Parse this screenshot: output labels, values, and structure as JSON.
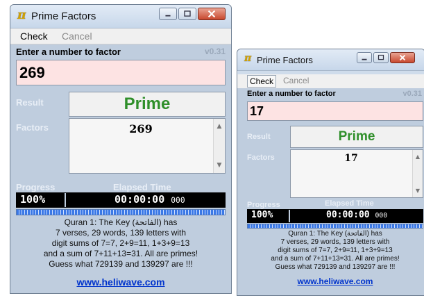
{
  "windows": [
    {
      "title": "Prime Factors",
      "app_glyph": "π",
      "menu": {
        "check": "Check",
        "cancel": "Cancel"
      },
      "prompt": "Enter a number to factor",
      "version": "v0.31",
      "number_value": "269",
      "result_label": "Result",
      "result_value": "Prime",
      "factors_label": "Factors",
      "factors_value": "269",
      "progress_label": "Progress",
      "elapsed_label": "Elapsed Time",
      "progress_value": "100%",
      "progress_fraction": 1.0,
      "elapsed_value": "00:00:00",
      "elapsed_ms": "000",
      "note_lines": [
        "Quran 1: The Key (الفاتحة) has",
        "7 verses, 29 words, 139 letters with",
        "digit sums of 7=7, 2+9=11, 1+3+9=13",
        "and a sum of 7+11+13=31. All are primes!",
        "Guess what 729139 and 139297 are !!!"
      ],
      "link_text": "www.heliwave.com"
    },
    {
      "title": "Prime Factors",
      "app_glyph": "π",
      "menu": {
        "check": "Check",
        "cancel": "Cancel"
      },
      "prompt": "Enter a number to factor",
      "version": "v0.31",
      "number_value": "17",
      "result_label": "Result",
      "result_value": "Prime",
      "factors_label": "Factors",
      "factors_value": "17",
      "progress_label": "Progress",
      "elapsed_label": "Elapsed Time",
      "progress_value": "100%",
      "progress_fraction": 1.0,
      "elapsed_value": "00:00:00",
      "elapsed_ms": "000",
      "note_lines": [
        "Quran 1: The Key (الفاتحة) has",
        "7 verses, 29 words, 139 letters with",
        "digit sums of 7=7, 2+9=11, 1+3+9=13",
        "and a sum of 7+11+13=31. All are primes!",
        "Guess what 729139 and 139297 are !!!"
      ],
      "link_text": "www.heliwave.com"
    }
  ],
  "icons": {
    "minimize": "minimize-icon",
    "maximize": "maximize-icon",
    "close": "close-icon",
    "scroll_up": "chevron-up-icon",
    "scroll_down": "chevron-down-icon"
  },
  "colors": {
    "window_bg": "#bfcdde",
    "input_bg": "#fde3e3",
    "result_green": "#2f8f2a",
    "progress_blue": "#3a78e6",
    "link_blue": "#0033cc"
  }
}
